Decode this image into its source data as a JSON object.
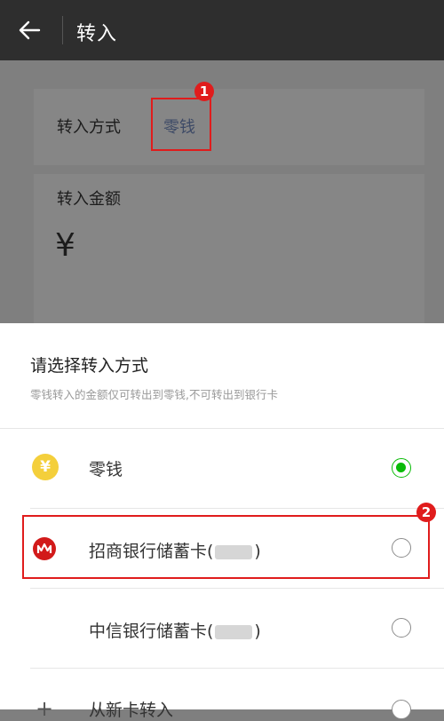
{
  "header": {
    "title": "转入"
  },
  "form": {
    "method_label": "转入方式",
    "method_value": "零钱",
    "amount_label": "转入金额",
    "currency_symbol": "¥"
  },
  "sheet": {
    "title": "请选择转入方式",
    "subtitle": "零钱转入的金额仅可转出到零钱,不可转出到银行卡",
    "options": [
      {
        "label": "零钱",
        "icon": "coin-icon",
        "selected": true
      },
      {
        "label_prefix": "招商银行储蓄卡(",
        "label_suffix": ")",
        "icon": "cmb-bank-icon",
        "selected": false
      },
      {
        "label_prefix": "中信银行储蓄卡(",
        "label_suffix": ")",
        "icon": "",
        "selected": false
      },
      {
        "label": "从新卡转入",
        "icon": "plus-icon",
        "selected": false
      }
    ]
  },
  "annotations": {
    "badge_1": "1",
    "badge_2": "2"
  },
  "colors": {
    "accent_green": "#09bb07",
    "annotation_red": "#e01c1c",
    "coin_yellow": "#f4cf3b",
    "bank_red": "#d21a1a"
  }
}
